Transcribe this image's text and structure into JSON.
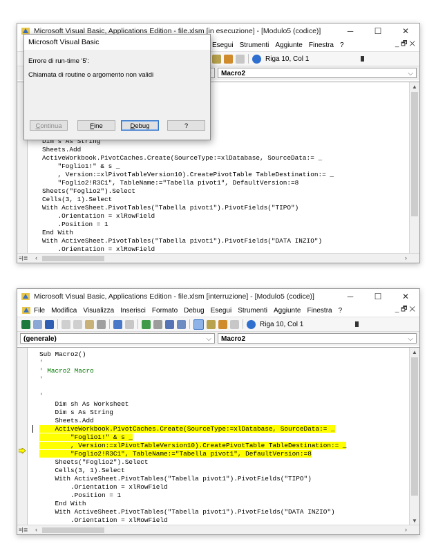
{
  "window1": {
    "title": "Microsoft Visual Basic, Applications Edition - file.xlsm [in esecuzione] - [Modulo5 (codice)]",
    "menu_visible": [
      "Esegui",
      "Strumenti",
      "Aggiunte",
      "Finestra",
      "?"
    ],
    "position": "Riga 10, Col 1",
    "procedure": "Macro2",
    "code_lines": [
      "Dim s As String",
      "Sheets.Add",
      "ActiveWorkbook.PivotCaches.Create(SourceType:=xlDatabase, SourceData:= _",
      "    \"Foglio1!\" & s _",
      "    , Version:=xlPivotTableVersion10).CreatePivotTable TableDestination:= _",
      "    \"Foglio2!R3C1\", TableName:=\"Tabella pivot1\", DefaultVersion:=8",
      "Sheets(\"Foglio2\").Select",
      "Cells(3, 1).Select",
      "With ActiveSheet.PivotTables(\"Tabella pivot1\").PivotFields(\"TIPO\")",
      "    .Orientation = xlRowField",
      "    .Position = 1",
      "End With",
      "With ActiveSheet.PivotTables(\"Tabella pivot1\").PivotFields(\"DATA INZIO\")",
      "    .Orientation = xlRowField"
    ]
  },
  "dialog": {
    "title": "Microsoft Visual Basic",
    "error": "Errore di run-time '5':",
    "message": "Chiamata di routine o argomento non validi",
    "buttons": {
      "continua": "Continua",
      "fine": "Fine",
      "debug": "Debug",
      "help": "?"
    }
  },
  "window2": {
    "title": "Microsoft Visual Basic, Applications Edition - file.xlsm [interruzione] - [Modulo5 (codice)]",
    "menu": [
      "File",
      "Modifica",
      "Visualizza",
      "Inserisci",
      "Formato",
      "Debug",
      "Esegui",
      "Strumenti",
      "Aggiunte",
      "Finestra",
      "?"
    ],
    "position": "Riga 10, Col 1",
    "object": "(generale)",
    "procedure": "Macro2",
    "code_lines": [
      {
        "t": "Sub Macro2()",
        "k": ""
      },
      {
        "t": "'",
        "k": "cm"
      },
      {
        "t": "' Macro2 Macro",
        "k": "cm"
      },
      {
        "t": "'",
        "k": "cm"
      },
      {
        "t": "",
        "k": ""
      },
      {
        "t": "'",
        "k": "cm"
      },
      {
        "t": "    Dim sh As Worksheet",
        "k": ""
      },
      {
        "t": "    Dim s As String",
        "k": ""
      },
      {
        "t": "    Sheets.Add",
        "k": ""
      },
      {
        "t": "    ActiveWorkbook.PivotCaches.Create(SourceType:=xlDatabase, SourceData:= _",
        "k": "hl"
      },
      {
        "t": "        \"Foglio1!\" & s _",
        "k": "hl"
      },
      {
        "t": "        , Version:=xlPivotTableVersion10).CreatePivotTable TableDestination:= _",
        "k": "hl"
      },
      {
        "t": "        \"Foglio2!R3C1\", TableName:=\"Tabella pivot1\", DefaultVersion:=8",
        "k": "hl"
      },
      {
        "t": "    Sheets(\"Foglio2\").Select",
        "k": ""
      },
      {
        "t": "    Cells(3, 1).Select",
        "k": ""
      },
      {
        "t": "    With ActiveSheet.PivotTables(\"Tabella pivot1\").PivotFields(\"TIPO\")",
        "k": ""
      },
      {
        "t": "        .Orientation = xlRowField",
        "k": ""
      },
      {
        "t": "        .Position = 1",
        "k": ""
      },
      {
        "t": "    End With",
        "k": ""
      },
      {
        "t": "    With ActiveSheet.PivotTables(\"Tabella pivot1\").PivotFields(\"DATA INZIO\")",
        "k": ""
      },
      {
        "t": "        .Orientation = xlRowField",
        "k": ""
      }
    ]
  },
  "colors": {
    "highlight": "#ffff00",
    "comment": "#007a00",
    "accent": "#2b6fc7"
  }
}
